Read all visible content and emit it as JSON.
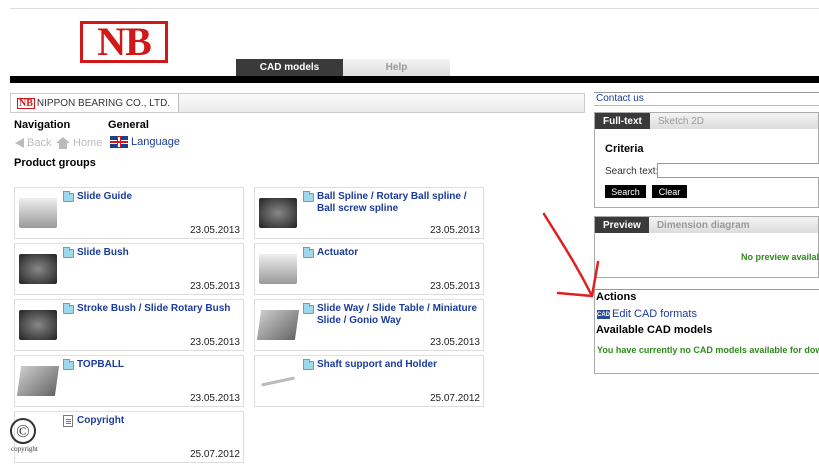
{
  "header": {
    "logo_text": "NB",
    "tabs": [
      {
        "label": "CAD models",
        "active": true
      },
      {
        "label": "Help",
        "active": false
      }
    ]
  },
  "breadcrumb": {
    "logo": "NB",
    "label": "NIPPON BEARING CO., LTD."
  },
  "navigation": {
    "heading": "Navigation",
    "general_heading": "General",
    "back_label": "Back",
    "home_label": "Home",
    "language_label": "Language"
  },
  "product_groups": {
    "heading": "Product groups",
    "items": [
      {
        "title": "Slide Guide",
        "date": "23.05.2013",
        "icon": "folder-icon"
      },
      {
        "title": "Ball Spline / Rotary Ball spline / Ball screw spline",
        "date": "23.05.2013",
        "icon": "folder-icon"
      },
      {
        "title": "Slide Bush",
        "date": "23.05.2013",
        "icon": "folder-icon"
      },
      {
        "title": "Actuator",
        "date": "23.05.2013",
        "icon": "folder-icon"
      },
      {
        "title": "Stroke Bush / Slide Rotary Bush",
        "date": "23.05.2013",
        "icon": "folder-icon"
      },
      {
        "title": "Slide Way / Slide Table / Miniature Slide / Gonio Way",
        "date": "23.05.2013",
        "icon": "folder-icon"
      },
      {
        "title": "TOPBALL",
        "date": "23.05.2013",
        "icon": "folder-icon"
      },
      {
        "title": "Shaft support and Holder",
        "date": "25.07.2012",
        "icon": "folder-icon"
      },
      {
        "title": "Copyright",
        "date": "25.07.2012",
        "icon": "document-icon"
      }
    ],
    "copyright_symbol": "©",
    "copyright_word": "copyright"
  },
  "right_panel": {
    "contact_label": "Contact us",
    "search_tabs": [
      {
        "label": "Full-text",
        "active": true
      },
      {
        "label": "Sketch 2D",
        "active": false
      }
    ],
    "criteria_heading": "Criteria",
    "search_label": "Search text:",
    "search_value": "",
    "search_button": "Search",
    "clear_button": "Clear",
    "preview_tabs": [
      {
        "label": "Preview",
        "active": true
      },
      {
        "label": "Dimension diagram",
        "active": false
      }
    ],
    "no_preview_text": "No preview availab",
    "actions_heading": "Actions",
    "cad_icon_text": "CAD",
    "edit_cad_label": "Edit CAD formats",
    "available_heading": "Available CAD models",
    "no_models_text": "You have currently no CAD models available for dow"
  },
  "colors": {
    "brand_red": "#d01818",
    "link_blue": "#1b3c9a",
    "message_green": "#2e8b1a",
    "annotation_red": "#e02020"
  }
}
